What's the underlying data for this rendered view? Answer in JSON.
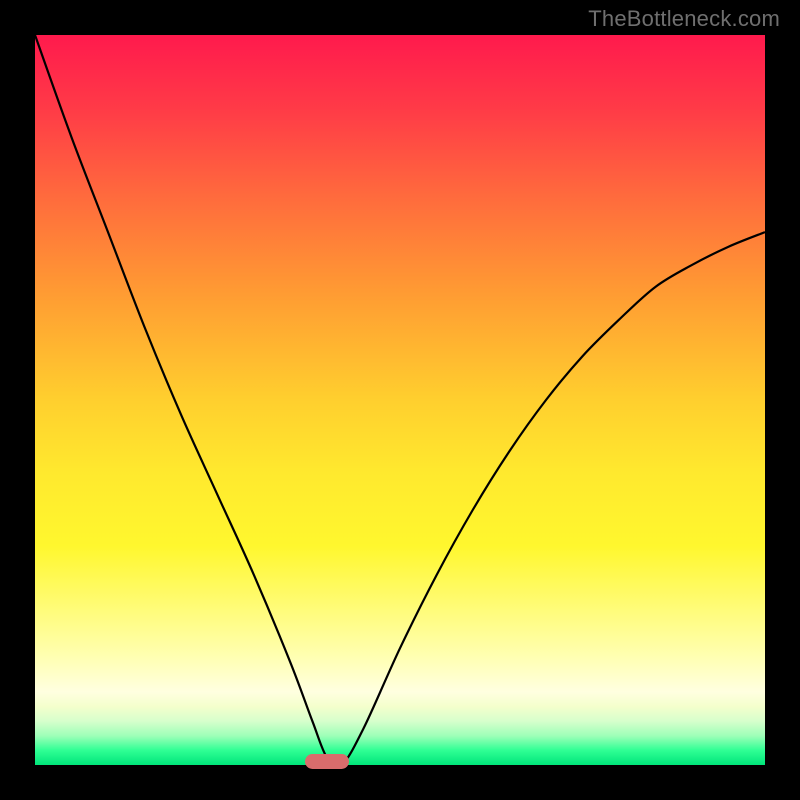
{
  "watermark": "TheBottleneck.com",
  "chart_data": {
    "type": "line",
    "title": "",
    "xlabel": "",
    "ylabel": "",
    "xlim": [
      0,
      100
    ],
    "ylim": [
      0,
      100
    ],
    "grid": false,
    "legend": false,
    "series": [
      {
        "name": "curve",
        "x": [
          0,
          5,
          10,
          15,
          20,
          25,
          30,
          35,
          38,
          40,
          42,
          45,
          50,
          55,
          60,
          65,
          70,
          75,
          80,
          85,
          90,
          95,
          100
        ],
        "y": [
          100,
          86,
          73,
          60,
          48,
          37,
          26,
          14,
          6,
          1,
          0,
          5,
          16,
          26,
          35,
          43,
          50,
          56,
          61,
          65.5,
          68.5,
          71,
          73
        ]
      }
    ],
    "marker": {
      "x_center": 40,
      "y": 0.5,
      "width": 6,
      "height": 2,
      "color": "#d96c6c"
    }
  },
  "colors": {
    "frame": "#000000",
    "gradient_top": "#ff1a4d",
    "gradient_mid": "#ffe92e",
    "gradient_bottom": "#00e57a",
    "curve": "#000000",
    "marker": "#d96c6c",
    "watermark": "#6f6f6f"
  }
}
